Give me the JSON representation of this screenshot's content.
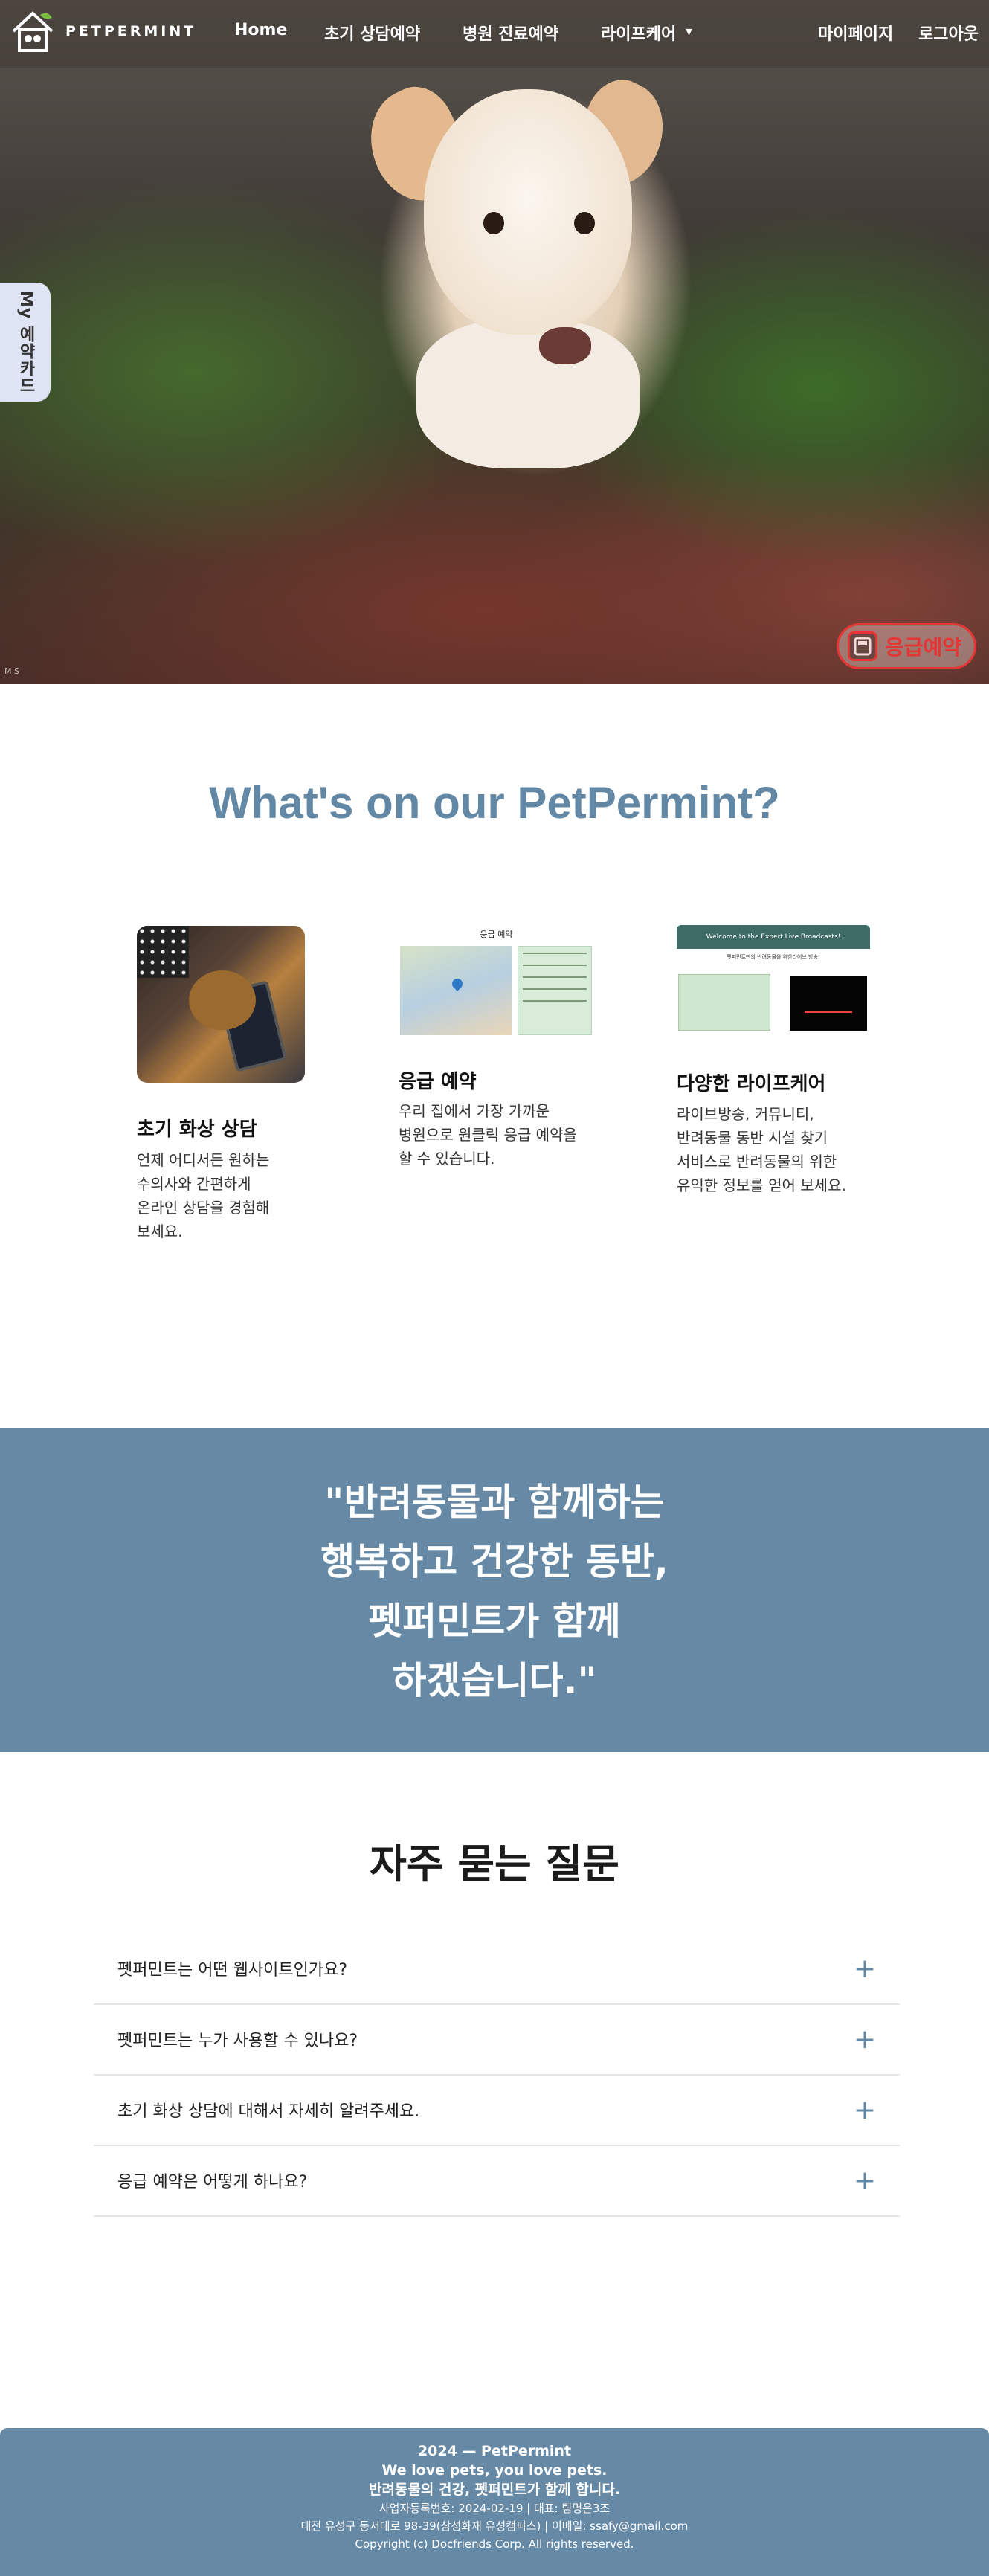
{
  "nav": {
    "logo_text": "PETPERMINT",
    "items": [
      "Home",
      "초기 상담예약",
      "병원 진료예약",
      "라이프케어"
    ],
    "dropdown_caret": "▾",
    "right": [
      "마이페이지",
      "로그아웃"
    ]
  },
  "hero": {
    "side_tab_label": "My 예약카드",
    "corner_mark": "M S",
    "emergency_label": "응급예약"
  },
  "features": {
    "title": "What's on our PetPermint?",
    "cards": [
      {
        "title": "초기 화상 상담",
        "desc": [
          "언제 어디서든 원하는",
          "수의사와 간편하게",
          "온라인 상담을 경험해",
          "보세요."
        ]
      },
      {
        "title": "응급 예약",
        "desc": [
          "우리 집에서 가장 가까운",
          "병원으로 원클릭 응급 예약을",
          "할 수 있습니다."
        ]
      },
      {
        "title": "다양한 라이프케어",
        "desc": [
          "라이브방송, 커뮤니티,",
          "반려동물 동반 시설 찾기",
          "서비스로 반려동물의 위한",
          "유익한 정보를 얻어 보세요."
        ]
      }
    ],
    "map_thumb_title": "응급 예약",
    "life_thumb_title": "Welcome to the Expert Live Broadcasts!",
    "life_thumb_sub": "펫퍼민트만의 반려동물을 위한라이브 방송!"
  },
  "banner": {
    "lines": [
      "\"반려동물과 함께하는",
      "행복하고 건강한 동반,",
      "펫퍼민트가 함께",
      "하겠습니다.\""
    ]
  },
  "faq": {
    "title": "자주 묻는 질문",
    "items": [
      {
        "q": "펫퍼민트는 어떤 웹사이트인가요?"
      },
      {
        "q": "펫퍼민트는 누가 사용할 수 있나요?"
      },
      {
        "q": "초기 화상 상담에 대해서 자세히 알려주세요."
      },
      {
        "q": "응급 예약은 어떻게 하나요?"
      }
    ],
    "plus": "+"
  },
  "footer": {
    "line1": "2024 — PetPermint",
    "line2": "We love pets, you love pets.",
    "line3": "반려동물의 건강, 펫퍼민트가 함께 합니다.",
    "line4": "사업자등록번호: 2024-02-19 | 대표: 팀명은3조",
    "line5": "대전 유성구 동서대로 98-39(삼성화재 유성캠퍼스) | 이메일: ssafy@gmail.com",
    "line6": "Copyright (c) Docfriends Corp. All rights reserved."
  },
  "colors": {
    "accent": "#6388a6",
    "banner_bg": "#6689a6",
    "emergency": "#e53535"
  }
}
